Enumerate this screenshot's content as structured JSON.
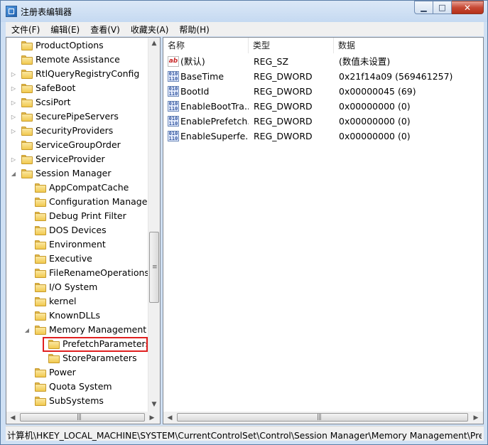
{
  "window": {
    "title": "注册表编辑器",
    "minimize_glyph": "▁",
    "maximize_glyph": "□",
    "close_glyph": "✕"
  },
  "menu": [
    "文件(F)",
    "编辑(E)",
    "查看(V)",
    "收藏夹(A)",
    "帮助(H)"
  ],
  "tree": {
    "items": [
      {
        "label": "ProductOptions",
        "expander": ""
      },
      {
        "label": "Remote Assistance",
        "expander": ""
      },
      {
        "label": "RtlQueryRegistryConfig",
        "expander": "▷"
      },
      {
        "label": "SafeBoot",
        "expander": "▷"
      },
      {
        "label": "ScsiPort",
        "expander": "▷"
      },
      {
        "label": "SecurePipeServers",
        "expander": "▷"
      },
      {
        "label": "SecurityProviders",
        "expander": "▷"
      },
      {
        "label": "ServiceGroupOrder",
        "expander": ""
      },
      {
        "label": "ServiceProvider",
        "expander": "▷"
      },
      {
        "label": "Session Manager",
        "expander": "◢"
      },
      {
        "label": "AppCompatCache",
        "expander": ""
      },
      {
        "label": "Configuration Manager",
        "expander": ""
      },
      {
        "label": "Debug Print Filter",
        "expander": ""
      },
      {
        "label": "DOS Devices",
        "expander": ""
      },
      {
        "label": "Environment",
        "expander": ""
      },
      {
        "label": "Executive",
        "expander": ""
      },
      {
        "label": "FileRenameOperations",
        "expander": ""
      },
      {
        "label": "I/O System",
        "expander": ""
      },
      {
        "label": "kernel",
        "expander": ""
      },
      {
        "label": "KnownDLLs",
        "expander": ""
      },
      {
        "label": "Memory Management",
        "expander": "◢"
      },
      {
        "label": "PrefetchParameters",
        "expander": ""
      },
      {
        "label": "StoreParameters",
        "expander": ""
      },
      {
        "label": "Power",
        "expander": ""
      },
      {
        "label": "Quota System",
        "expander": ""
      },
      {
        "label": "SubSystems",
        "expander": ""
      }
    ],
    "selected": "PrefetchParameters",
    "up_arrow": "▲",
    "down_arrow": "▼",
    "left_arrow": "◀",
    "right_arrow": "▶",
    "grip": "≡",
    "hgrip": "|||"
  },
  "list": {
    "columns": [
      "名称",
      "类型",
      "数据"
    ],
    "rows": [
      {
        "icon": "string-value-icon",
        "glyph": "ab",
        "name": "(默认)",
        "type": "REG_SZ",
        "data": "(数值未设置)"
      },
      {
        "icon": "dword-value-icon",
        "glyph": "010\n110",
        "name": "BaseTime",
        "type": "REG_DWORD",
        "data": "0x21f14a09 (569461257)"
      },
      {
        "icon": "dword-value-icon",
        "glyph": "010\n110",
        "name": "BootId",
        "type": "REG_DWORD",
        "data": "0x00000045 (69)"
      },
      {
        "icon": "dword-value-icon",
        "glyph": "010\n110",
        "name": "EnableBootTra...",
        "type": "REG_DWORD",
        "data": "0x00000000 (0)"
      },
      {
        "icon": "dword-value-icon",
        "glyph": "010\n110",
        "name": "EnablePrefetch...",
        "type": "REG_DWORD",
        "data": "0x00000000 (0)"
      },
      {
        "icon": "dword-value-icon",
        "glyph": "010\n110",
        "name": "EnableSuperfe...",
        "type": "REG_DWORD",
        "data": "0x00000000 (0)"
      }
    ],
    "left_arrow": "◀",
    "right_arrow": "▶",
    "hgrip": "|||"
  },
  "statusbar": {
    "path": "计算机\\HKEY_LOCAL_MACHINE\\SYSTEM\\CurrentControlSet\\Control\\Session Manager\\Memory Management\\Pre"
  },
  "colors": {
    "selection_outline": "#e02020",
    "window_frame": "#cfe0f4",
    "close_button": "#c74a36"
  }
}
